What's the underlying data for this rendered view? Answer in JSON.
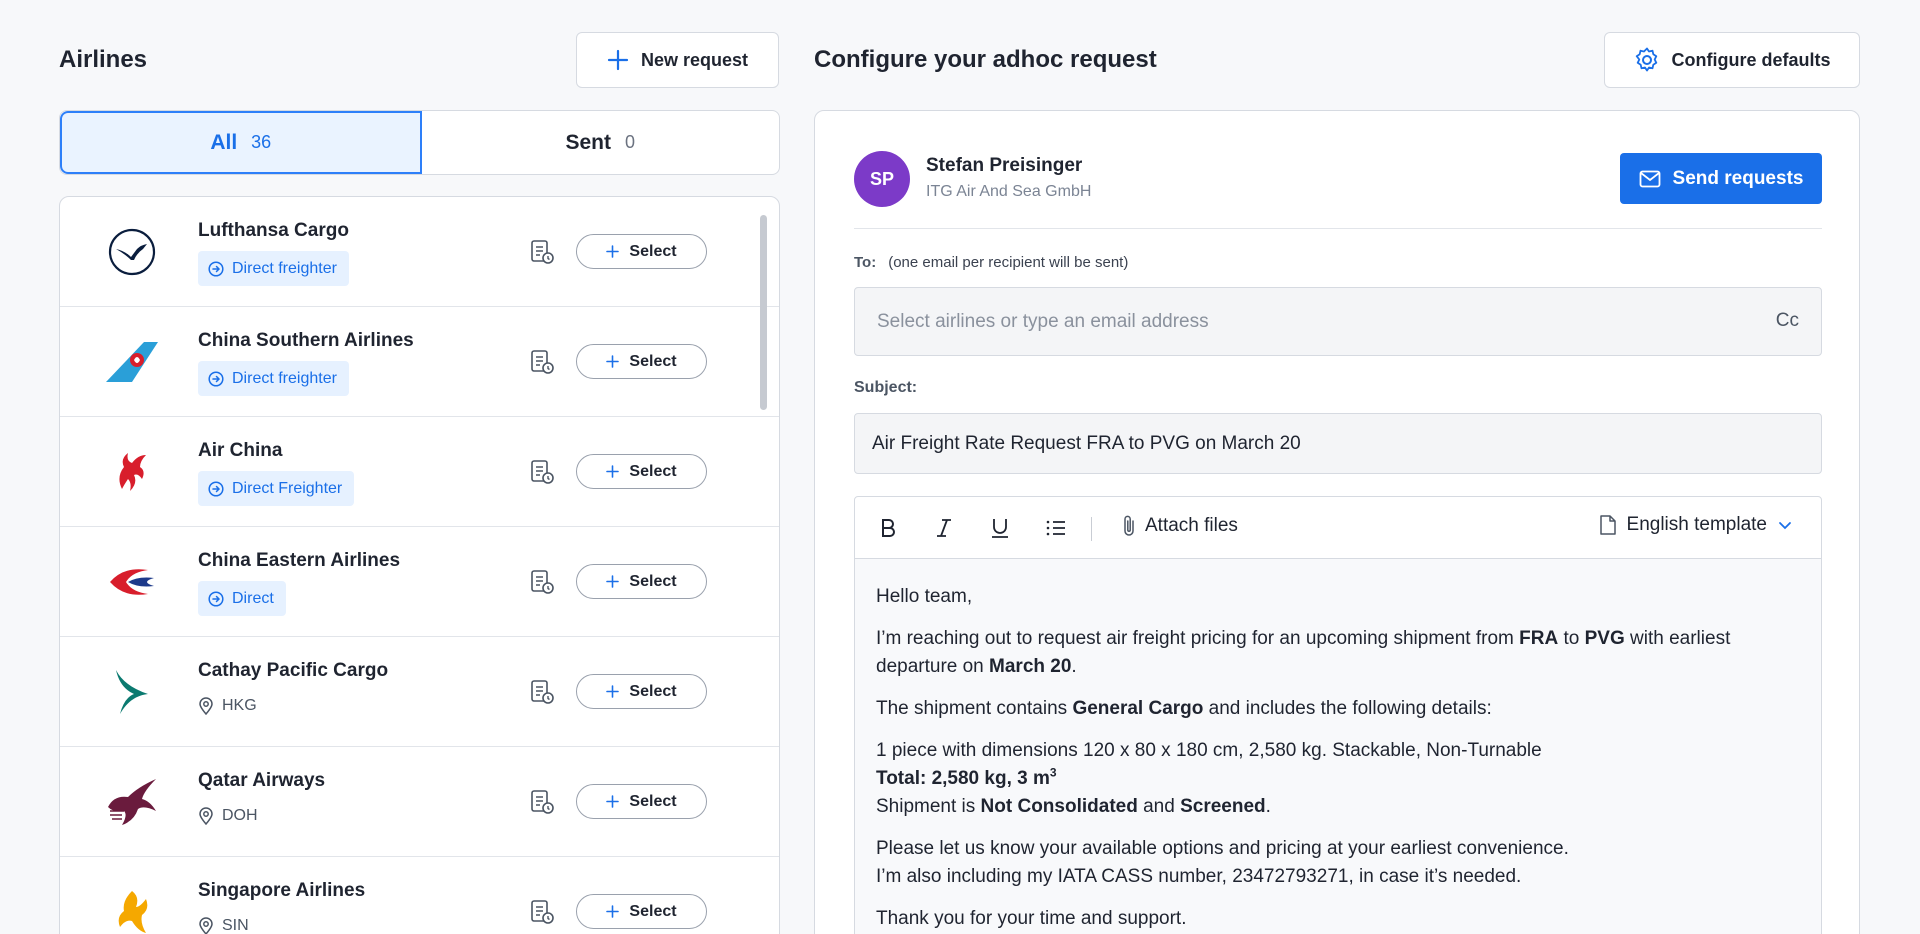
{
  "left": {
    "title": "Airlines",
    "new_request_label": "New request",
    "tabs": [
      {
        "label": "All",
        "count": "36"
      },
      {
        "label": "Sent",
        "count": "0"
      }
    ],
    "select_label": "Select",
    "airlines": [
      {
        "name": "Lufthansa Cargo",
        "tag": "Direct freighter",
        "tag_type": "badge"
      },
      {
        "name": "China Southern Airlines",
        "tag": "Direct freighter",
        "tag_type": "badge"
      },
      {
        "name": "Air China",
        "tag": "Direct Freighter",
        "tag_type": "badge"
      },
      {
        "name": "China Eastern Airlines",
        "tag": "Direct",
        "tag_type": "badge"
      },
      {
        "name": "Cathay Pacific Cargo",
        "tag": "HKG",
        "tag_type": "location"
      },
      {
        "name": "Qatar Airways",
        "tag": "DOH",
        "tag_type": "location"
      },
      {
        "name": "Singapore Airlines",
        "tag": "SIN",
        "tag_type": "location"
      }
    ]
  },
  "right": {
    "title": "Configure your adhoc request",
    "configure_label": "Configure defaults",
    "sender": {
      "initials": "SP",
      "name": "Stefan Preisinger",
      "company": "ITG Air And Sea GmbH"
    },
    "send_label": "Send requests",
    "to_label": "To:",
    "to_hint": "(one email per recipient will be sent)",
    "to_placeholder": "Select airlines or type an email address",
    "cc_label": "Cc",
    "subject_label": "Subject:",
    "subject_value": "Air Freight Rate Request FRA to PVG on March 20",
    "toolbar": {
      "attach_label": "Attach files",
      "template_label": "English template"
    },
    "email": {
      "greeting": "Hello team,",
      "p1_a": "I’m reaching out to request air freight pricing for an upcoming shipment from ",
      "p1_from": "FRA",
      "p1_b": " to ",
      "p1_to": "PVG",
      "p1_c": " with earliest departure on ",
      "p1_date": "March 20",
      "p1_d": ".",
      "p2_a": "The shipment contains ",
      "p2_cargo": "General Cargo",
      "p2_b": " and includes the following details:",
      "p3_line1": "1 piece with dimensions 120 x 80 x 180 cm, 2,580 kg. Stackable, Non-Turnable",
      "p3_total": "Total: 2,580 kg, 3 m",
      "p3_sup": "3",
      "p3_c": "Shipment is ",
      "p3_consol": "Not Consolidated",
      "p3_d": " and ",
      "p3_screen": "Screened",
      "p3_e": ".",
      "p4_line1": "Please let us know your available options and pricing at your earliest convenience.",
      "p4_line2": "I’m also including my IATA CASS number, 23472793271, in case it’s needed.",
      "p5": "Thank you for your time and support."
    }
  },
  "colors": {
    "accent": "#1a6fe8",
    "avatar": "#7c3ac8",
    "badge_bg": "#e6f1ff"
  }
}
